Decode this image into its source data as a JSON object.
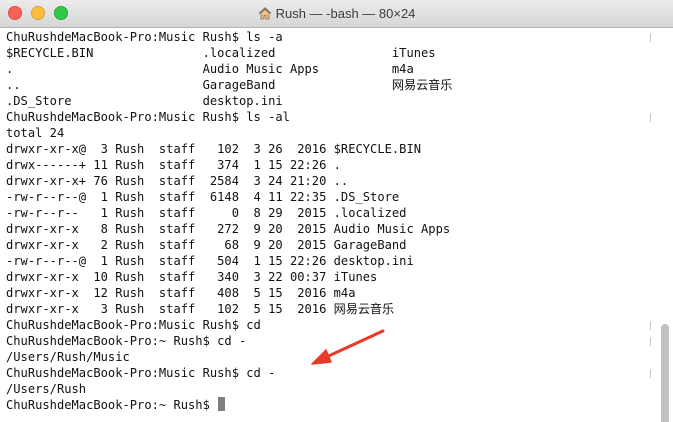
{
  "window": {
    "title": "Rush — -bash — 80×24",
    "title_icon": "home-icon"
  },
  "terminal": {
    "lines": [
      "ChuRushdeMacBook-Pro:Music Rush$ ls -a",
      "$RECYCLE.BIN               .localized                iTunes",
      ".                          Audio Music Apps          m4a",
      "..                         GarageBand                网易云音乐",
      ".DS_Store                  desktop.ini",
      "ChuRushdeMacBook-Pro:Music Rush$ ls -al",
      "total 24",
      "drwxr-xr-x@  3 Rush  staff   102  3 26  2016 $RECYCLE.BIN",
      "drwx------+ 11 Rush  staff   374  1 15 22:26 .",
      "drwxr-xr-x+ 76 Rush  staff  2584  3 24 21:20 ..",
      "-rw-r--r--@  1 Rush  staff  6148  4 11 22:35 .DS_Store",
      "-rw-r--r--   1 Rush  staff     0  8 29  2015 .localized",
      "drwxr-xr-x   8 Rush  staff   272  9 20  2015 Audio Music Apps",
      "drwxr-xr-x   2 Rush  staff    68  9 20  2015 GarageBand",
      "-rw-r--r--@  1 Rush  staff   504  1 15 22:26 desktop.ini",
      "drwxr-xr-x  10 Rush  staff   340  3 22 00:37 iTunes",
      "drwxr-xr-x  12 Rush  staff   408  5 15  2016 m4a",
      "drwxr-xr-x   3 Rush  staff   102  5 15  2016 网易云音乐",
      "ChuRushdeMacBook-Pro:Music Rush$ cd",
      "ChuRushdeMacBook-Pro:~ Rush$ cd -",
      "/Users/Rush/Music",
      "ChuRushdeMacBook-Pro:Music Rush$ cd -",
      "/Users/Rush",
      "ChuRushdeMacBook-Pro:~ Rush$ "
    ]
  },
  "colors": {
    "annotation_arrow": "#e8392a",
    "text": "#111111",
    "cursor": "#7f7f7f"
  }
}
